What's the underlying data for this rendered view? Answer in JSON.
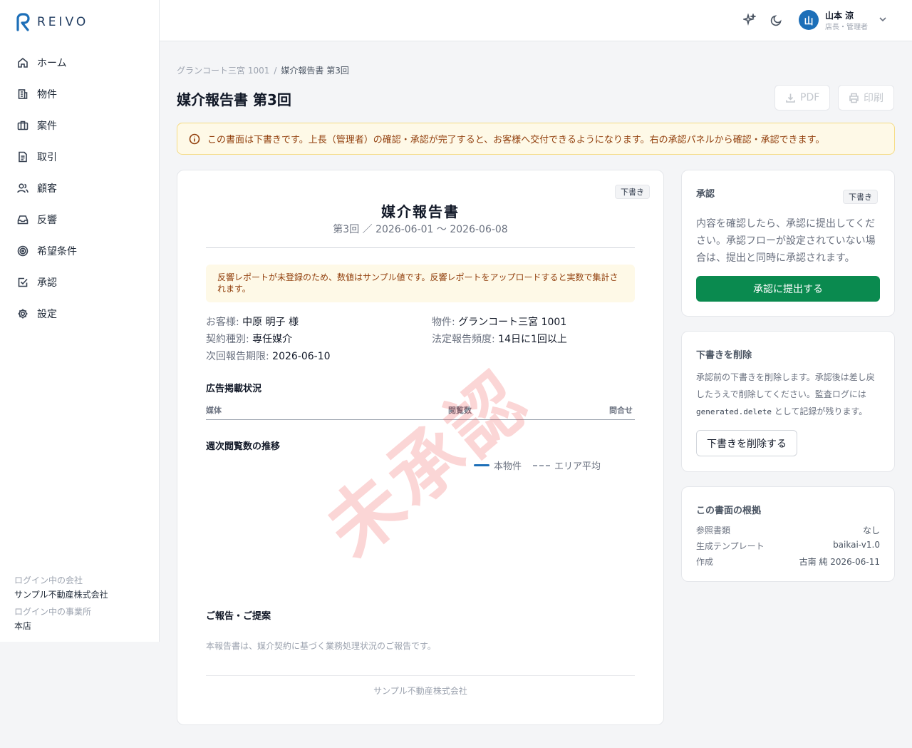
{
  "brand": {
    "name": "REIVO",
    "color": "#1d6fb8"
  },
  "sidebar": {
    "items": [
      {
        "label": "ホーム",
        "icon": "home-icon"
      },
      {
        "label": "物件",
        "icon": "building-icon"
      },
      {
        "label": "案件",
        "icon": "briefcase-icon"
      },
      {
        "label": "取引",
        "icon": "document-icon"
      },
      {
        "label": "顧客",
        "icon": "users-icon"
      },
      {
        "label": "反響",
        "icon": "inbox-icon"
      },
      {
        "label": "希望条件",
        "icon": "target-icon"
      },
      {
        "label": "承認",
        "icon": "check-square-icon"
      },
      {
        "label": "設定",
        "icon": "gear-icon"
      }
    ],
    "company_label": "ログイン中の会社",
    "company": "サンプル不動産株式会社",
    "office_label": "ログイン中の事業所",
    "office": "本店"
  },
  "header": {
    "user_initial": "山",
    "user_name": "山本 涼",
    "user_role": "店長・管理者"
  },
  "breadcrumb": {
    "parent": "グランコート三宮 1001",
    "sep": "/",
    "current": "媒介報告書 第3回"
  },
  "page": {
    "title": "媒介報告書 第3回",
    "pdf_label": "PDF",
    "print_label": "印刷",
    "alert": "この書面は下書きです。上長（管理者）の確認・承認が完了すると、お客様へ交付できるようになります。右の承認パネルから確認・承認できます。"
  },
  "document": {
    "badge": "下書き",
    "title": "媒介報告書",
    "subtitle": "第3回 ／ 2026-06-01 〜 2026-06-08",
    "sample_note": "反響レポートが未登録のため、数値はサンプル値です。反響レポートをアップロードすると実数で集計されます。",
    "fields": {
      "customer_k": "お客様:",
      "customer_v": "中原 明子 様",
      "property_k": "物件:",
      "property_v": "グランコート三宮 1001",
      "contract_k": "契約種別:",
      "contract_v": "専任媒介",
      "freq_k": "法定報告頻度:",
      "freq_v": "14日に1回以上",
      "next_k": "次回報告期限:",
      "next_v": "2026-06-10"
    },
    "ad_section": "広告掲載状況",
    "columns": [
      "媒体",
      "閲覧数",
      "問合せ"
    ],
    "chart_section": "週次閲覧数の推移",
    "legend": {
      "own": "本物件",
      "area": "エリア平均"
    },
    "watermark": "未承認",
    "proposal_section": "ご報告・ご提案",
    "body": "本報告書は、媒介契約に基づく業務処理状況のご報告です。",
    "footer": "サンプル不動産株式会社"
  },
  "approval": {
    "title": "承認",
    "badge": "下書き",
    "text": "内容を確認したら、承認に提出してください。承認フローが設定されていない場合は、提出と同時に承認されます。",
    "button": "承認に提出する"
  },
  "delete_panel": {
    "title": "下書きを削除",
    "text_before": "承認前の下書きを削除します。承認後は差し戻したうえで削除してください。監査ログには",
    "code": "generated.delete",
    "text_after": "として記録が残ります。",
    "button": "下書きを削除する"
  },
  "basis": {
    "title": "この書面の根拠",
    "rows": [
      {
        "k": "参照書類",
        "v": "なし"
      },
      {
        "k": "生成テンプレート",
        "v": "baikai-v1.0"
      },
      {
        "k": "作成",
        "v": "古南 純 2026-06-11"
      }
    ]
  }
}
